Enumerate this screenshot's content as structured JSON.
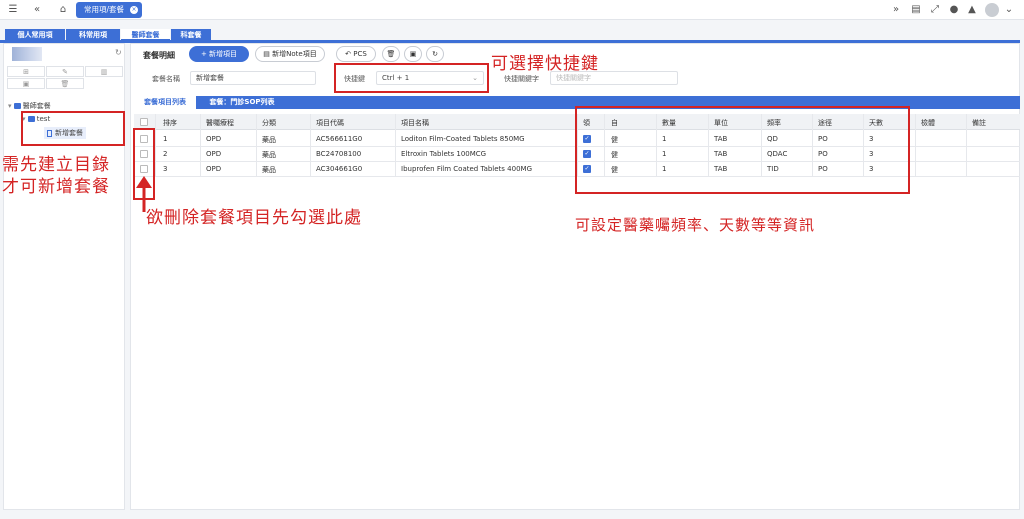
{
  "topbar": {
    "menu_icon": "hamburger-icon",
    "collapse_icon": "double-chevron-left-icon",
    "home_icon": "home-icon",
    "active_tab": "常用項/套餐",
    "right_icons": [
      "double-chevron-right-icon",
      "document-icon",
      "expand-icon",
      "chat-icon",
      "bell-icon",
      "avatar",
      "chevron-down-icon"
    ]
  },
  "category_tabs": [
    "個人常用項",
    "科常用項",
    "醫師套餐",
    "科套餐"
  ],
  "category_active": "醫師套餐",
  "tree": {
    "root": "醫師套餐",
    "folder": "test",
    "item": "新增套餐"
  },
  "section_title": "套餐明細",
  "buttons": {
    "add_item": "+ 新增項目",
    "add_note": "新增Note項目",
    "pcs": "PCS"
  },
  "form": {
    "name_label": "套餐名稱",
    "name_value": "新增套餐",
    "shortcut_label": "快捷鍵",
    "shortcut_value": "Ctrl + 1",
    "keyword_label": "快捷關鍵字",
    "keyword_placeholder": "快捷關鍵字"
  },
  "sub_tabs": [
    "套餐項目列表",
    "套餐：門診SOP列表"
  ],
  "table": {
    "headers": [
      "排序",
      "醫囑療程",
      "分類",
      "項目代碼",
      "項目名稱",
      "領",
      "自",
      "數量",
      "單位",
      "頻率",
      "途徑",
      "天數",
      "檢體",
      "備註"
    ],
    "rows": [
      {
        "seq": "1",
        "course": "OPD",
        "category": "藥品",
        "code": "AC566611G0",
        "name": "Loditon Film-Coated Tablets 850MG",
        "take": true,
        "self": "健",
        "qty": "1",
        "unit": "TAB",
        "freq": "QD",
        "route": "PO",
        "days": "3"
      },
      {
        "seq": "2",
        "course": "OPD",
        "category": "藥品",
        "code": "BC24708100",
        "name": "Eltroxin Tablets 100MCG",
        "take": true,
        "self": "健",
        "qty": "1",
        "unit": "TAB",
        "freq": "QDAC",
        "route": "PO",
        "days": "3"
      },
      {
        "seq": "3",
        "course": "OPD",
        "category": "藥品",
        "code": "AC304661G0",
        "name": "Ibuprofen Film Coated Tablets 400MG",
        "take": true,
        "self": "健",
        "qty": "1",
        "unit": "TAB",
        "freq": "TID",
        "route": "PO",
        "days": "3"
      }
    ]
  },
  "annotations": {
    "shortcut": "可選擇快捷鍵",
    "folder_line1": "需先建立目錄",
    "folder_line2": "才可新增套餐",
    "delete": "欲刪除套餐項目先勾選此處",
    "settings": "可設定醫藥囑頻率、天數等等資訊"
  },
  "colors": {
    "accent": "#3d6fd6",
    "annotation": "#d42424"
  }
}
